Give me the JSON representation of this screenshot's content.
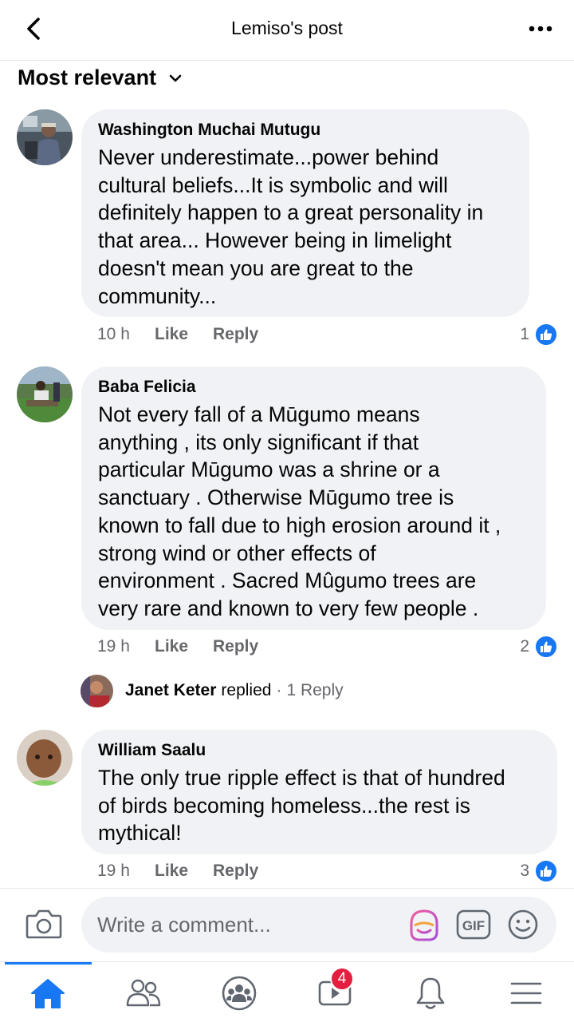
{
  "header": {
    "title": "Lemiso's post",
    "back_icon": "chevron-left-icon",
    "more_icon": "more-horizontal-icon"
  },
  "sort": {
    "label": "Most relevant",
    "icon": "chevron-down-icon"
  },
  "comments": [
    {
      "author": "Washington Muchai Mutugu",
      "text": "Never underestimate...power behind\ncultural beliefs...It is symbolic and will\ndefinitely happen to a great personality in\nthat area... However being in limelight\ndoesn't mean you are great to the\ncommunity...",
      "time": "10 h",
      "like_label": "Like",
      "reply_label": "Reply",
      "reaction_count": "1"
    },
    {
      "author": "Baba Felicia",
      "text": "Not every fall of a Mūgumo means\nanything , its only significant if that\nparticular Mūgumo was a shrine or a\nsanctuary . Otherwise Mūgumo tree is\nknown to fall due to high erosion around it ,\nstrong wind or other effects of\nenvironment . Sacred Mûgumo trees are\nvery rare and known to very few people .",
      "time": "19 h",
      "like_label": "Like",
      "reply_label": "Reply",
      "reaction_count": "2"
    },
    {
      "author": "William Saalu",
      "text": "The only true ripple effect is that of hundred\nof birds becoming homeless...the rest is\nmythical!",
      "time": "19 h",
      "like_label": "Like",
      "reply_label": "Reply",
      "reaction_count": "3"
    }
  ],
  "reply_summary": {
    "name": "Janet Keter",
    "verb": "replied",
    "separator": "·",
    "count": "1 Reply"
  },
  "composer": {
    "placeholder": "Write a comment...",
    "gif_label": "GIF",
    "icons": [
      "camera-icon",
      "avatar-sticker-icon",
      "gif-icon",
      "emoji-icon"
    ]
  },
  "bottom_nav": {
    "items": [
      "home-icon",
      "friends-icon",
      "groups-icon",
      "watch-icon",
      "notifications-icon",
      "menu-icon"
    ],
    "watch_badge": "4"
  },
  "colors": {
    "accent": "#1877f2",
    "bubble": "#f0f2f5",
    "secondary_text": "#65676b",
    "badge": "#e41e3f"
  }
}
